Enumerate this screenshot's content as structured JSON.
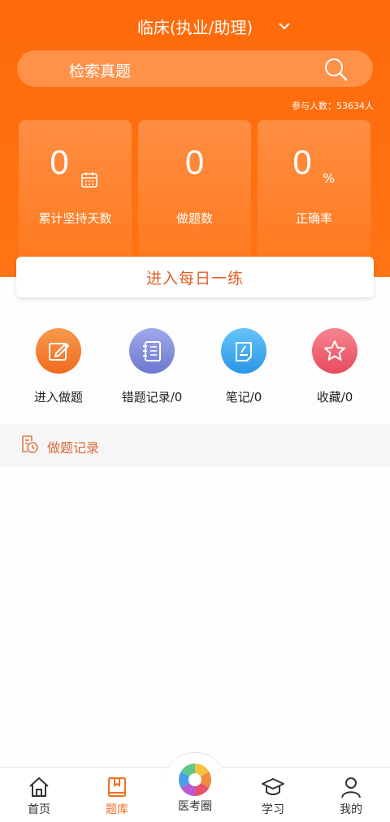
{
  "header": {
    "exam_title": "临床(执业/助理)",
    "search_placeholder": "检索真题",
    "participants": "参与人数：53634人"
  },
  "stats": [
    {
      "value": "0",
      "label": "累计坚持天数",
      "icon": "calendar-icon"
    },
    {
      "value": "0",
      "label": "做题数"
    },
    {
      "value": "0",
      "suffix": "%",
      "label": "正确率"
    }
  ],
  "daily_button": "进入每日一练",
  "quick_actions": [
    {
      "label": "进入做题",
      "icon": "edit-icon",
      "color": "#f27a2b"
    },
    {
      "label": "错题记录/0",
      "icon": "notebook-icon",
      "color": "#7b86d6"
    },
    {
      "label": "笔记/0",
      "icon": "note-icon",
      "color": "#3aa8ef"
    },
    {
      "label": "收藏/0",
      "icon": "star-icon",
      "color": "#ef5a6c"
    }
  ],
  "record_section": {
    "title": "做题记录",
    "icon": "clock-doc-icon"
  },
  "tabbar": {
    "items": [
      {
        "label": "首页",
        "icon": "home-icon"
      },
      {
        "label": "题库",
        "icon": "book-icon",
        "active": true
      },
      {
        "label": "医考圈",
        "icon": "camera-aperture-icon"
      },
      {
        "label": "学习",
        "icon": "graduation-cap-icon"
      },
      {
        "label": "我的",
        "icon": "user-icon"
      }
    ]
  },
  "colors": {
    "brand": "#ff6a0a",
    "accent_text": "#e0602a",
    "active_tab": "#f07022"
  }
}
